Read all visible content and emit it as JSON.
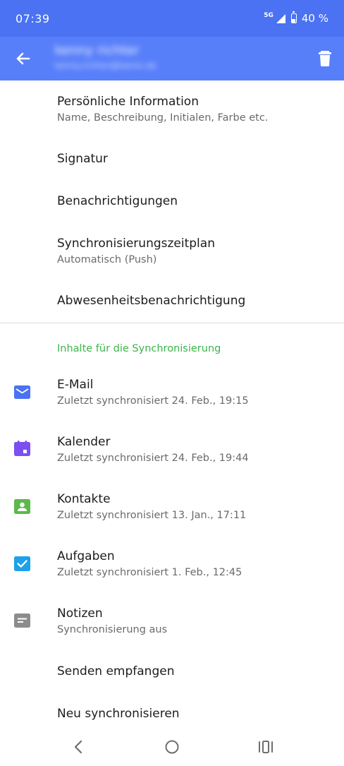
{
  "status_bar": {
    "time": "07:39",
    "network": "5G",
    "battery": "40 %"
  },
  "app_bar": {
    "account_name": "kenny richter",
    "account_email": "kenny.richter@kwmx.de",
    "back_icon": "arrow-left-icon",
    "delete_icon": "trash-icon"
  },
  "settings": [
    {
      "title": "Persönliche Information",
      "subtitle": "Name, Beschreibung, Initialen, Farbe etc."
    },
    {
      "title": "Signatur"
    },
    {
      "title": "Benachrichtigungen"
    },
    {
      "title": "Synchronisierungszeitplan",
      "subtitle": "Automatisch (Push)"
    },
    {
      "title": "Abwesenheitsbenachrichtigung"
    }
  ],
  "sync_section": {
    "header": "Inhalte für die Synchronisierung",
    "items": [
      {
        "title": "E-Mail",
        "subtitle": "Zuletzt synchronisiert 24. Feb., 19:15",
        "icon": "mail-icon",
        "color": "#4a72f2"
      },
      {
        "title": "Kalender",
        "subtitle": "Zuletzt synchronisiert 24. Feb., 19:44",
        "icon": "calendar-icon",
        "color": "#7c4ff0"
      },
      {
        "title": "Kontakte",
        "subtitle": "Zuletzt synchronisiert 13. Jan., 17:11",
        "icon": "contact-icon",
        "color": "#5bb94a"
      },
      {
        "title": "Aufgaben",
        "subtitle": "Zuletzt synchronisiert 1. Feb., 12:45",
        "icon": "task-checkbox-icon",
        "color": "#1ea1ea"
      },
      {
        "title": "Notizen",
        "subtitle": "Synchronisierung aus",
        "icon": "note-icon",
        "color": "#8c8c8c"
      }
    ]
  },
  "actions": [
    {
      "title": "Senden empfangen"
    },
    {
      "title": "Neu synchronisieren"
    }
  ],
  "nav_bar": {
    "back_icon": "nav-back-icon",
    "home_icon": "nav-home-icon",
    "recents_icon": "nav-recents-icon"
  }
}
